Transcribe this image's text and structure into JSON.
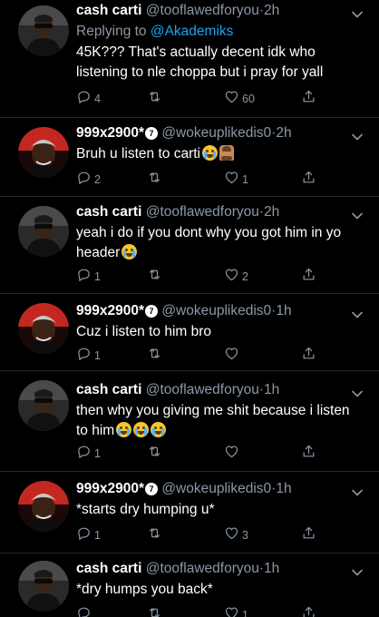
{
  "colors": {
    "background": "#000000",
    "text": "#ffffff",
    "secondary_text": "#8b98a5",
    "link": "#1da1f2",
    "divider": "#22272b"
  },
  "tweets": [
    {
      "name": "cash carti",
      "handle": "@tooflawedforyou",
      "time": "2h",
      "verified_badge": "",
      "replying_prefix": "Replying to",
      "replying_mention": "@Akademiks",
      "text": "45K??? That's actually decent idk who listening to nle choppa but i pray for yall",
      "emojis": [],
      "reply_count": "4",
      "retweet_count": "",
      "like_count": "60"
    },
    {
      "name": "999x2900*",
      "handle": "@wokeuplikedis0",
      "time": "2h",
      "verified_badge": "7",
      "text": "Bruh u listen to carti",
      "emojis": [
        "crying-face-emoji",
        "person-facepalming-emoji"
      ],
      "reply_count": "2",
      "retweet_count": "",
      "like_count": "1"
    },
    {
      "name": "cash carti",
      "handle": "@tooflawedforyou",
      "time": "2h",
      "verified_badge": "",
      "text": "yeah i do if you dont why you got him in yo header",
      "emojis": [
        "tears-of-joy-emoji"
      ],
      "reply_count": "1",
      "retweet_count": "",
      "like_count": "2"
    },
    {
      "name": "999x2900*",
      "handle": "@wokeuplikedis0",
      "time": "1h",
      "verified_badge": "7",
      "text": "Cuz i listen to him bro",
      "emojis": [],
      "reply_count": "1",
      "retweet_count": "",
      "like_count": ""
    },
    {
      "name": "cash carti",
      "handle": "@tooflawedforyou",
      "time": "1h",
      "verified_badge": "",
      "text": "then why you giving me shit because i listen to him",
      "emojis": [
        "loudly-crying-emoji",
        "loudly-crying-emoji",
        "loudly-crying-emoji"
      ],
      "reply_count": "1",
      "retweet_count": "",
      "like_count": ""
    },
    {
      "name": "999x2900*",
      "handle": "@wokeuplikedis0",
      "time": "1h",
      "verified_badge": "7",
      "text": "*starts dry humping u*",
      "emojis": [],
      "reply_count": "1",
      "retweet_count": "",
      "like_count": "3"
    },
    {
      "name": "cash carti",
      "handle": "@tooflawedforyou",
      "time": "1h",
      "verified_badge": "",
      "text": "*dry humps you back*",
      "emojis": [],
      "reply_count": "",
      "retweet_count": "",
      "like_count": "1"
    }
  ],
  "separator": "·",
  "icons": {
    "reply": "reply-icon",
    "retweet": "retweet-icon",
    "like": "like-icon",
    "share": "share-icon",
    "caret": "chevron-down-icon"
  }
}
